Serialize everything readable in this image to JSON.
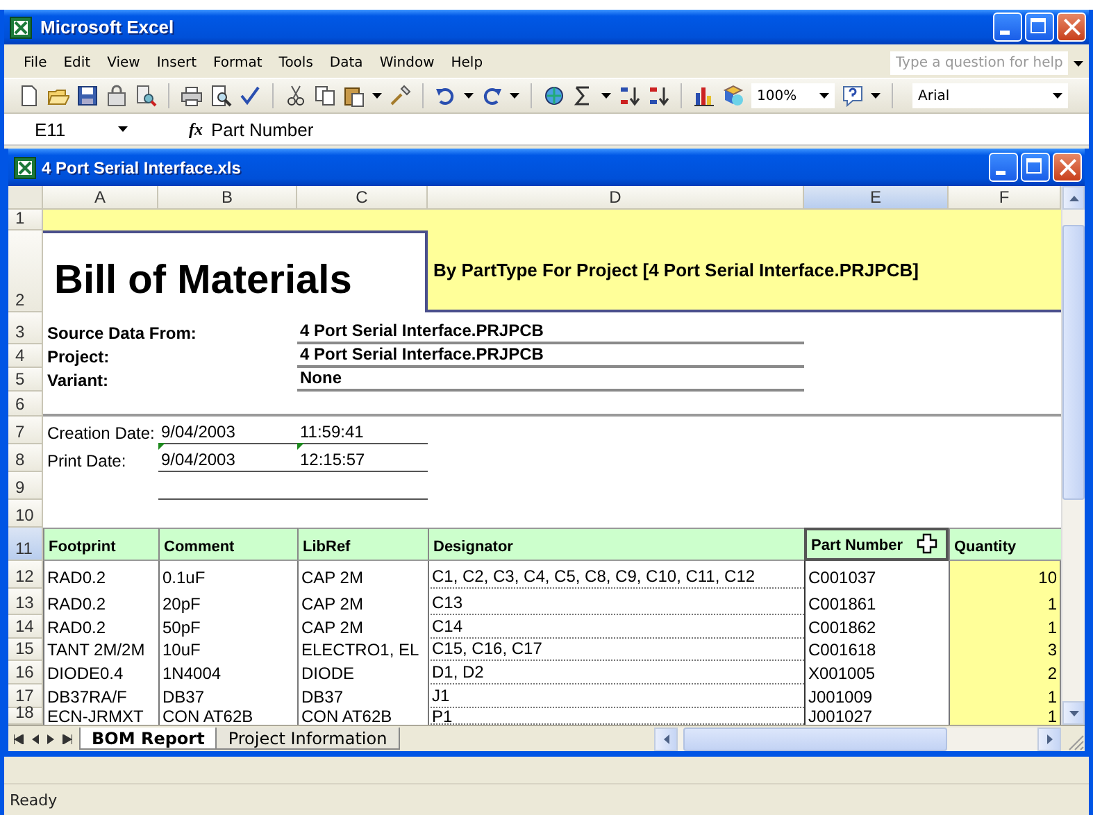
{
  "app_window": {
    "title": "Microsoft Excel"
  },
  "menu": [
    "File",
    "Edit",
    "View",
    "Insert",
    "Format",
    "Tools",
    "Data",
    "Window",
    "Help"
  ],
  "help_box": {
    "placeholder": "Type a question for help"
  },
  "toolbar": {
    "zoom": "100%",
    "font": "Arial"
  },
  "formula_bar": {
    "cell_reference": "E11",
    "function_symbol": "fx",
    "formula": "Part Number"
  },
  "workbook_window": {
    "title": "4 Port Serial Interface.xls"
  },
  "column_headers": [
    {
      "label": "A",
      "selected": false
    },
    {
      "label": "B",
      "selected": false
    },
    {
      "label": "C",
      "selected": false
    },
    {
      "label": "D",
      "selected": false
    },
    {
      "label": "E",
      "selected": true
    },
    {
      "label": "F",
      "selected": false
    }
  ],
  "row_headers": [
    {
      "label": "1",
      "selected": false
    },
    {
      "label": "2",
      "selected": false
    },
    {
      "label": "3",
      "selected": false
    },
    {
      "label": "4",
      "selected": false
    },
    {
      "label": "5",
      "selected": false
    },
    {
      "label": "6",
      "selected": false
    },
    {
      "label": "7",
      "selected": false
    },
    {
      "label": "8",
      "selected": false
    },
    {
      "label": "9",
      "selected": false
    },
    {
      "label": "10",
      "selected": false
    },
    {
      "label": "11",
      "selected": true
    },
    {
      "label": "12",
      "selected": false
    },
    {
      "label": "13",
      "selected": false
    },
    {
      "label": "14",
      "selected": false
    },
    {
      "label": "15",
      "selected": false
    },
    {
      "label": "16",
      "selected": false
    },
    {
      "label": "17",
      "selected": false
    },
    {
      "label": "18",
      "selected": false
    }
  ],
  "report": {
    "title": "Bill of Materials",
    "subtitle": "By PartType For Project [4 Port Serial Interface.PRJPCB]",
    "info": [
      {
        "label": "Source Data From:",
        "value": "4 Port Serial Interface.PRJPCB"
      },
      {
        "label": "Project:",
        "value": "4 Port Serial Interface.PRJPCB"
      },
      {
        "label": "Variant:",
        "value": "None"
      }
    ],
    "dates": [
      {
        "label": "Creation Date:",
        "date": "9/04/2003",
        "time": "11:59:41",
        "error_indicator": false
      },
      {
        "label": "Print Date:",
        "date": "9/04/2003",
        "time": "12:15:57",
        "error_indicator": true
      }
    ],
    "table": {
      "columns": [
        {
          "label": "Footprint",
          "selected": false
        },
        {
          "label": "Comment",
          "selected": false
        },
        {
          "label": "LibRef",
          "selected": false
        },
        {
          "label": "Designator",
          "selected": false
        },
        {
          "label": "Part Number",
          "selected": true
        },
        {
          "label": "Quantity",
          "selected": false
        }
      ],
      "rows": [
        [
          "RAD0.2",
          "0.1uF",
          "CAP 2M",
          "C1, C2, C3, C4, C5, C8, C9, C10, C11, C12",
          "C001037",
          "10"
        ],
        [
          "RAD0.2",
          "20pF",
          "CAP 2M",
          "C13",
          "C001861",
          "1"
        ],
        [
          "RAD0.2",
          "50pF",
          "CAP 2M",
          "C14",
          "C001862",
          "1"
        ],
        [
          "TANT 2M/2M",
          "10uF",
          "ELECTRO1, EL",
          "C15, C16, C17",
          "C001618",
          "3"
        ],
        [
          "DIODE0.4",
          "1N4004",
          "DIODE",
          "D1, D2",
          "X001005",
          "2"
        ],
        [
          "DB37RA/F",
          "DB37",
          "DB37",
          "J1",
          "J001009",
          "1"
        ],
        [
          "ECN-JRMXT",
          "CON AT62B",
          "CON AT62B",
          "P1",
          "J001027",
          "1"
        ]
      ]
    }
  },
  "sheet_tabs": [
    {
      "label": "BOM Report",
      "selected": true
    },
    {
      "label": "Project Information",
      "selected": false
    }
  ],
  "status_bar": "Ready"
}
